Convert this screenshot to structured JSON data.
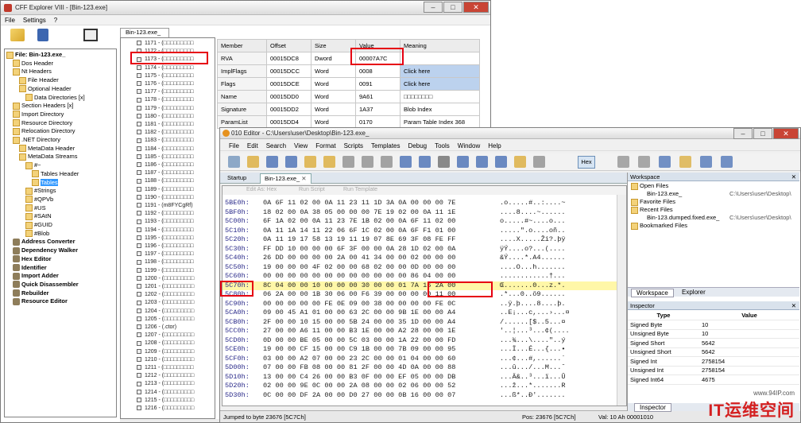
{
  "cff": {
    "title": "CFF Explorer VIII - [Bin-123.exe]",
    "menu": [
      "File",
      "Settings",
      "?"
    ],
    "tab": "Bin-123.exe_",
    "tree": [
      {
        "label": "File: Bin-123.exe_",
        "bold": true,
        "icon": "file"
      },
      {
        "label": "Dos Header",
        "icon": "folder"
      },
      {
        "label": "Nt Headers",
        "icon": "folder"
      },
      {
        "label": "File Header",
        "icon": "folder"
      },
      {
        "label": "Optional Header",
        "icon": "folder"
      },
      {
        "label": "Data Directories [x]",
        "icon": "folder"
      },
      {
        "label": "Section Headers [x]",
        "icon": "folder"
      },
      {
        "label": "Import Directory",
        "icon": "folder"
      },
      {
        "label": "Resource Directory",
        "icon": "folder"
      },
      {
        "label": "Relocation Directory",
        "icon": "folder"
      },
      {
        "label": ".NET Directory",
        "icon": "folder"
      },
      {
        "label": "MetaData Header",
        "icon": "folder"
      },
      {
        "label": "MetaData Streams",
        "icon": "folder"
      },
      {
        "label": "#~",
        "icon": "folder"
      },
      {
        "label": "Tables Header",
        "icon": "folder"
      },
      {
        "label": "Tables",
        "icon": "folder",
        "selected": true
      },
      {
        "label": "#Strings",
        "icon": "folder"
      },
      {
        "label": "#QPVb",
        "icon": "folder"
      },
      {
        "label": "#US",
        "icon": "folder"
      },
      {
        "label": "#SAtN",
        "icon": "folder"
      },
      {
        "label": "#GUID",
        "icon": "folder"
      },
      {
        "label": "#Blob",
        "icon": "folder"
      },
      {
        "label": "Address Converter",
        "bold": true,
        "icon": "tool"
      },
      {
        "label": "Dependency Walker",
        "bold": true,
        "icon": "tool"
      },
      {
        "label": "Hex Editor",
        "bold": true,
        "icon": "tool"
      },
      {
        "label": "Identifier",
        "bold": true,
        "icon": "tool"
      },
      {
        "label": "Import Adder",
        "bold": true,
        "icon": "tool"
      },
      {
        "label": "Quick Disassembler",
        "bold": true,
        "icon": "tool"
      },
      {
        "label": "Rebuilder",
        "bold": true,
        "icon": "tool"
      },
      {
        "label": "Resource Editor",
        "bold": true,
        "icon": "tool"
      }
    ],
    "methods": [
      "1171 - (□□□□□□□□□",
      "1172 - (□□□□□□□□□",
      "1173 - (□□□□□□□□□",
      "1174 - (□□□□□□□□□",
      "1175 - (□□□□□□□□□",
      "1176 - (□□□□□□□□□",
      "1177 - (□□□□□□□□□",
      "1178 - (□□□□□□□□□",
      "1179 - (□□□□□□□□□",
      "1180 - (□□□□□□□□□",
      "1181 - (□□□□□□□□□",
      "1182 - (□□□□□□□□□",
      "1183 - (□□□□□□□□□",
      "1184 - (□□□□□□□□□",
      "1185 - (□□□□□□□□□",
      "1186 - (□□□□□□□□□",
      "1187 - (□□□□□□□□□",
      "1188 - (□□□□□□□□□",
      "1189 - (□□□□□□□□□",
      "1190 - (□□□□□□□□□",
      "1191 - (m8FYCgRf)",
      "1192 - (□□□□□□□□□",
      "1193 - (□□□□□□□□□",
      "1194 - (□□□□□□□□□",
      "1195 - (□□□□□□□□□",
      "1196 - (□□□□□□□□□",
      "1197 - (□□□□□□□□□",
      "1198 - (□□□□□□□□□",
      "1199 - (□□□□□□□□□",
      "1200 - (□□□□□□□□□",
      "1201 - (□□□□□□□□□",
      "1202 - (□□□□□□□□□",
      "1203 - (□□□□□□□□□",
      "1204 - (□□□□□□□□□",
      "1205 - (□□□□□□□□□",
      "1206 - (.ctor)",
      "1207 - (□□□□□□□□□",
      "1208 - (□□□□□□□□□",
      "1209 - (□□□□□□□□□",
      "1210 - (□□□□□□□□□",
      "1211 - (□□□□□□□□□",
      "1212 - (□□□□□□□□□",
      "1213 - (□□□□□□□□□",
      "1214 - (□□□□□□□□□",
      "1215 - (□□□□□□□□□",
      "1216 - (□□□□□□□□□"
    ],
    "grid": {
      "headers": [
        "Member",
        "Offset",
        "Size",
        "Value",
        "Meaning"
      ],
      "rows": [
        [
          "RVA",
          "00015DC8",
          "Dword",
          "00007A7C",
          ""
        ],
        [
          "ImplFlags",
          "00015DCC",
          "Word",
          "0008",
          "Click here"
        ],
        [
          "Flags",
          "00015DCE",
          "Word",
          "0091",
          "Click here"
        ],
        [
          "Name",
          "00015DD0",
          "Word",
          "9A61",
          "□□□□□□□□"
        ],
        [
          "Signature",
          "00015DD2",
          "Word",
          "1A37",
          "Blob Index"
        ],
        [
          "ParamList",
          "00015DD4",
          "Word",
          "0170",
          "Param Table Index 368"
        ]
      ]
    }
  },
  "editor": {
    "title": "010 Editor - C:\\Users\\user\\Desktop\\Bin-123.exe_",
    "menu": [
      "File",
      "Edit",
      "Search",
      "View",
      "Format",
      "Scripts",
      "Templates",
      "Debug",
      "Tools",
      "Window",
      "Help"
    ],
    "tabs": [
      "Startup",
      "Bin-123.exe_"
    ],
    "edit_as": "Edit As: Hex",
    "run_script": "Run Script",
    "run_template": "Run Template",
    "hex_btn": "Hex",
    "rows": [
      {
        "off": "5BE0h:",
        "bytes": "0A 6F 11 02 00 0A 11 23 11 1D 3A 0A 00 00 00 7E",
        "asc": ".o.....#..:....~"
      },
      {
        "off": "5BF0h:",
        "bytes": "18 02 00 0A 38 05 00 00 00 7E 19 02 00 0A 11 1E",
        "asc": "....8....~......"
      },
      {
        "off": "5C00h:",
        "bytes": "6F 1A 02 00 0A 11 23 7E 1B 02 00 0A 6F 11 02 00",
        "asc": "o.....#~....o..."
      },
      {
        "off": "5C10h:",
        "bytes": "0A 11 1A 14 11 22 06 6F 1C 02 00 0A 6F F1 01 00",
        "asc": ".....\".o....oñ.."
      },
      {
        "off": "5C20h:",
        "bytes": "0A 11 19 17 58 13 19 11 19 07 8E 69 3F 08 FE FF",
        "asc": "....X.....Ži?.þÿ"
      },
      {
        "off": "5C30h:",
        "bytes": "FF DD 10 00 00 00 6F 3F 00 00 0A 28 1D 02 00 0A",
        "asc": "ÿÝ....o?...(...."
      },
      {
        "off": "5C40h:",
        "bytes": "26 DD 00 00 00 00 2A 00 41 34 00 00 02 00 00 00",
        "asc": "&Ý....*.A4......"
      },
      {
        "off": "5C50h:",
        "bytes": "19 00 00 00 4F 02 00 00 68 02 00 00 0D 00 00 00",
        "asc": "....O...h......."
      },
      {
        "off": "5C60h:",
        "bytes": "00 00 00 00 00 00 00 00 00 00 00 00 86 04 00 00",
        "asc": "............†..."
      },
      {
        "off": "5C70h:",
        "bytes": "8C 04 00 00 10 00 00 00 30 00 00 01 7A 16 2A 00",
        "asc": "Œ.......0...z.*.",
        "hl": true
      },
      {
        "off": "5C80h:",
        "bytes": "06 2A 00 00 1B 30 06 00 F6 39 00 00 00 00 11 00",
        "asc": ".*...0..ö9......"
      },
      {
        "off": "5C90h:",
        "bytes": "00 00 00 00 00 FE 0E 09 00 38 00 00 00 00 FE 0C",
        "asc": "..ÿ.þ....8....þ."
      },
      {
        "off": "5CA0h:",
        "bytes": "09 00 45 A1 01 00 00 63 2C 00 00 9B 1E 00 00 A4",
        "asc": "..E¡...c,...›...¤"
      },
      {
        "off": "5CB0h:",
        "bytes": "2F 00 00 10 15 00 00 5B 24 00 00 35 1D 00 00 A4",
        "asc": "/......[$..5...¤"
      },
      {
        "off": "5CC0h:",
        "bytes": "27 00 00 A6 11 00 00 B3 1E 00 00 A2 28 00 00 1E",
        "asc": "'..¦...³...¢(...."
      },
      {
        "off": "5CD0h:",
        "bytes": "0D 00 00 BE 05 00 00 5C 03 00 00 1A 22 00 00 FD",
        "asc": "...¾...\\....\"..ý"
      },
      {
        "off": "5CE0h:",
        "bytes": "19 00 00 CF 15 00 00 C9 1B 00 00 7B 09 00 00 95",
        "asc": "...Ï...É...{...•"
      },
      {
        "off": "5CF0h:",
        "bytes": "03 00 00 A2 07 00 00 23 2C 00 00 01 04 00 00 60",
        "asc": "...¢...#,......`"
      },
      {
        "off": "5D00h:",
        "bytes": "07 00 00 FB 08 00 00 81 2F 00 00 4D 0A 00 00 88",
        "asc": "...û.../...M...ˆ"
      },
      {
        "off": "5D10h:",
        "bytes": "13 00 00 C4 26 00 00 B3 0F 00 00 EF 05 00 00 DB",
        "asc": "...Ä&..³...ï...Û"
      },
      {
        "off": "5D20h:",
        "bytes": "02 00 00 9E 0C 00 00 2A 08 00 00 02 06 00 00 52",
        "asc": "...ž...*.......R"
      },
      {
        "off": "5D30h:",
        "bytes": "0C 00 00 DF 2A 00 00 D0 27 00 00 0B 16 00 00 07",
        "asc": "...ß*..Ð'......."
      }
    ],
    "status_left": "Jumped to byte 23676 [5C7Ch]",
    "status_pos": "Pos: 23676 [5C7Ch]",
    "status_val": "Val: 10 Ah 00001010",
    "workspace": {
      "title": "Workspace",
      "open_files": "Open Files",
      "file1": "Bin-123.exe_",
      "file1_path": "C:\\Users\\user\\Desktop\\",
      "favorites": "Favorite Files",
      "recent": "Recent Files",
      "recent1": "Bin-123.dumped.fixed.exe_",
      "recent1_path": "C:\\Users\\user\\Desktop\\",
      "bookmarked": "Bookmarked Files",
      "tab_workspace": "Workspace",
      "tab_explorer": "Explorer"
    },
    "inspector": {
      "title": "Inspector",
      "col_type": "Type",
      "col_value": "Value",
      "rows": [
        [
          "Signed Byte",
          "10"
        ],
        [
          "Unsigned Byte",
          "10"
        ],
        [
          "Signed Short",
          "5642"
        ],
        [
          "Unsigned Short",
          "5642"
        ],
        [
          "Signed Int",
          "2758154"
        ],
        [
          "Unsigned Int",
          "2758154"
        ],
        [
          "Signed Int64",
          "4675"
        ]
      ],
      "tab_inspector": "Inspector"
    }
  },
  "watermark": {
    "site": "www.94IP.com",
    "brand": "IT运维空间"
  }
}
